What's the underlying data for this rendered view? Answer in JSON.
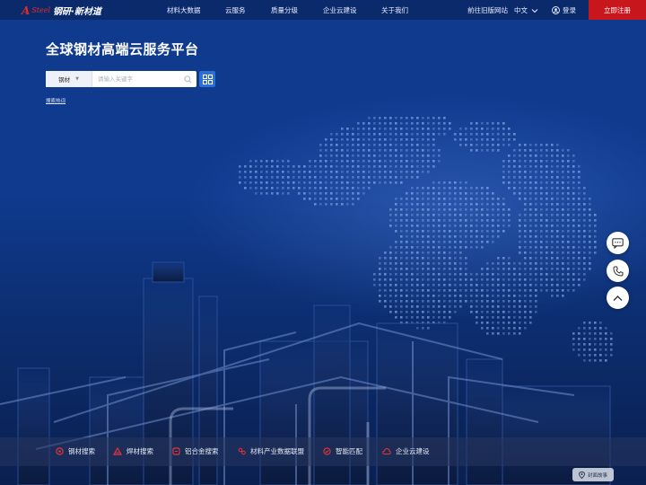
{
  "brand": {
    "mark": "A",
    "sub": "Steel",
    "name": "钢研·新材道"
  },
  "nav": {
    "links": [
      "材料大数据",
      "云服务",
      "质量分级",
      "企业云建设",
      "关于我们"
    ],
    "old_site": "前往旧版网站",
    "language": "中文",
    "login": "登录",
    "register": "立即注册"
  },
  "hero": {
    "title": "全球钢材高端云服务平台",
    "search": {
      "category": "钢材",
      "placeholder": "请输入关键字"
    },
    "hot_label": "搜索热词"
  },
  "bottom_menu": [
    "钢材搜索",
    "焊材搜索",
    "铝合金搜索",
    "材料产业数据联盟",
    "智能匹配",
    "企业云建设"
  ],
  "story_button": "封面故事",
  "colors": {
    "accent_red": "#c8161d",
    "accent_blue": "#2d6fd6",
    "hero_bg": "#0f3a8e"
  },
  "icons": [
    "search-icon",
    "grid-icon",
    "chat-icon",
    "phone-icon",
    "arrow-up-icon",
    "user-icon",
    "chevron-down-icon",
    "pin-icon"
  ]
}
